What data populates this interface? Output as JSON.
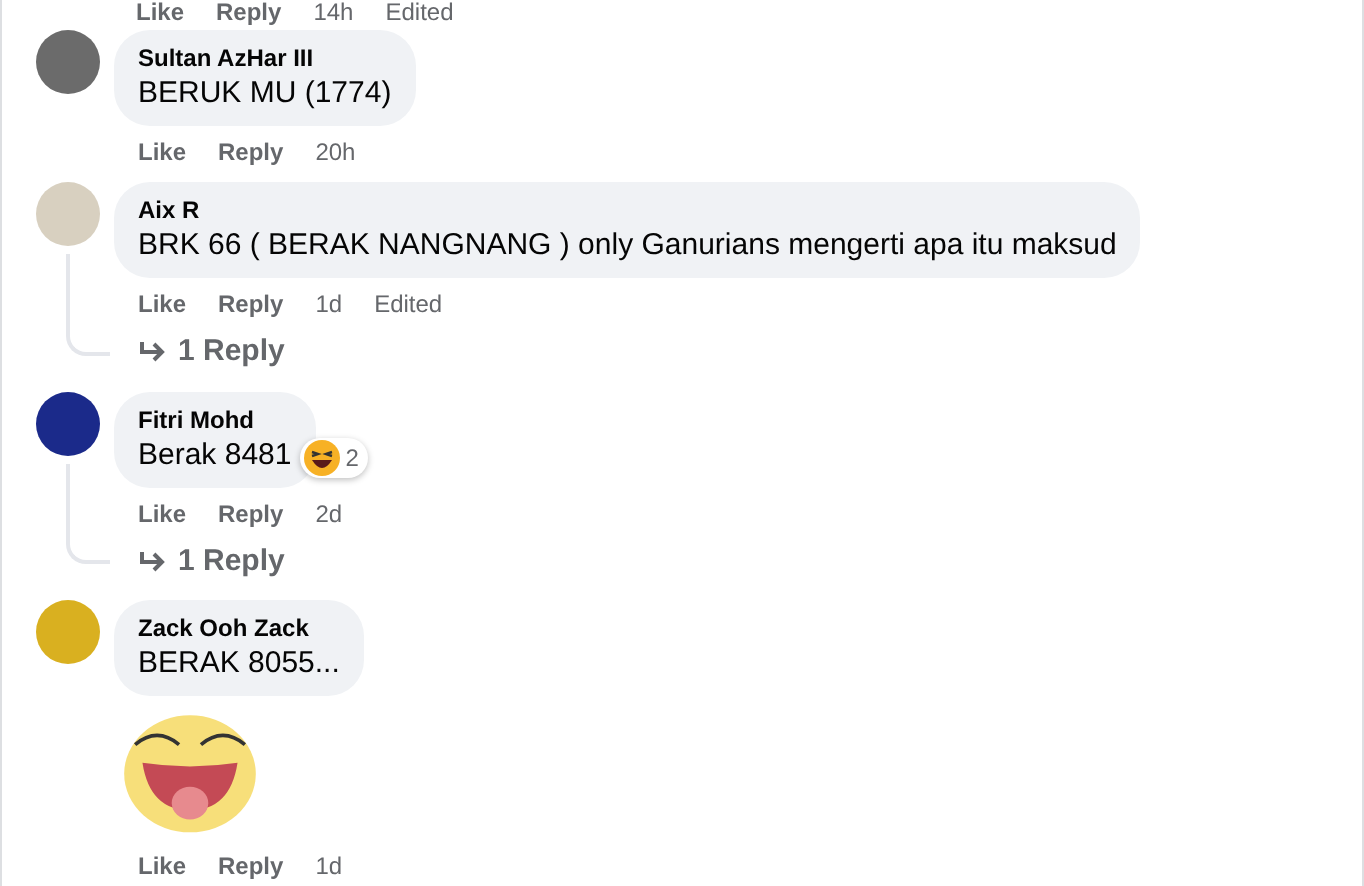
{
  "top_actions": {
    "like": "Like",
    "reply": "Reply",
    "time": "14h",
    "edited": "Edited"
  },
  "comments": [
    {
      "author": "Sultan AzHar III",
      "text": "BERUK MU (1774)",
      "actions": {
        "like": "Like",
        "reply": "Reply",
        "time": "20h"
      }
    },
    {
      "author": "Aix R",
      "text": "BRK 66 ( BERAK NANGNANG ) only Ganurians mengerti apa itu maksud",
      "actions": {
        "like": "Like",
        "reply": "Reply",
        "time": "1d"
      },
      "edited": "Edited",
      "replies": "1 Reply"
    },
    {
      "author": "Fitri Mohd",
      "text": "Berak 8481",
      "actions": {
        "like": "Like",
        "reply": "Reply",
        "time": "2d"
      },
      "reaction": {
        "count": "2"
      },
      "replies": "1 Reply"
    },
    {
      "author": "Zack Ooh Zack",
      "text": "BERAK 8055...",
      "actions": {
        "like": "Like",
        "reply": "Reply",
        "time": "1d"
      },
      "attachment": {
        "kind": "sticker"
      }
    }
  ]
}
